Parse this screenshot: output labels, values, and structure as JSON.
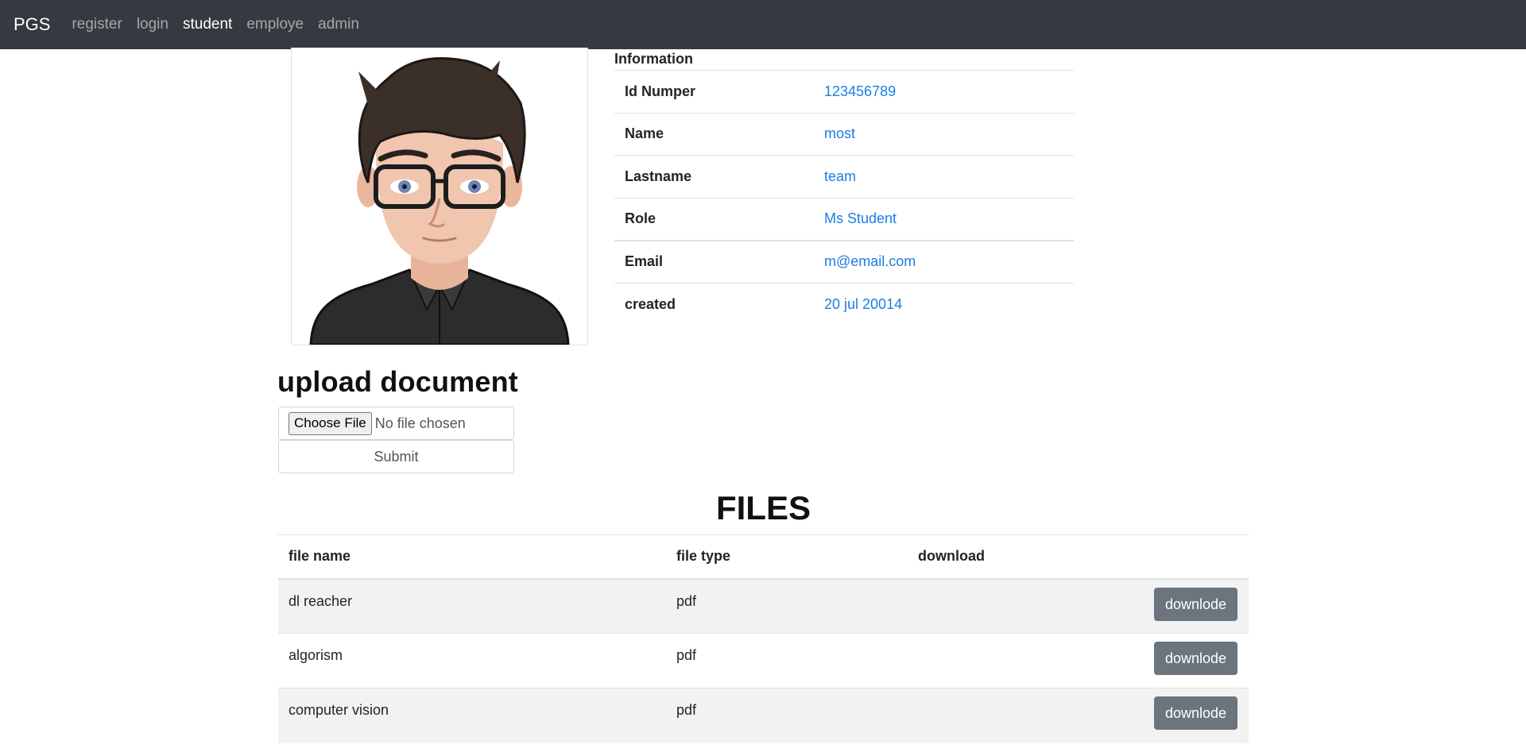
{
  "navbar": {
    "brand": "PGS",
    "links": [
      "register",
      "login",
      "student",
      "employe",
      "admin"
    ],
    "active": "student"
  },
  "info": {
    "caption": "Information",
    "rows": [
      {
        "label": "Id Numper",
        "value": "123456789"
      },
      {
        "label": "Name",
        "value": "most"
      },
      {
        "label": "Lastname",
        "value": "team"
      },
      {
        "label": "Role",
        "value": "Ms Student"
      },
      {
        "label": "Email",
        "value": "m@email.com"
      },
      {
        "label": "created",
        "value": "20 jul 20014"
      }
    ]
  },
  "upload": {
    "title": "upload document",
    "choose_label": "Choose File",
    "no_file_text": "No file chosen",
    "submit_label": "Submit"
  },
  "files": {
    "title": "FILES",
    "headers": [
      "file name",
      "file type",
      "download"
    ],
    "rows": [
      {
        "name": "dl reacher",
        "type": "pdf",
        "action": "downlode"
      },
      {
        "name": "algorism",
        "type": "pdf",
        "action": "downlode"
      },
      {
        "name": "computer vision",
        "type": "pdf",
        "action": "downlode"
      }
    ]
  },
  "colors": {
    "navbar_bg": "#343a40",
    "link_value": "#1a7fe3",
    "button_secondary": "#6c757d"
  }
}
